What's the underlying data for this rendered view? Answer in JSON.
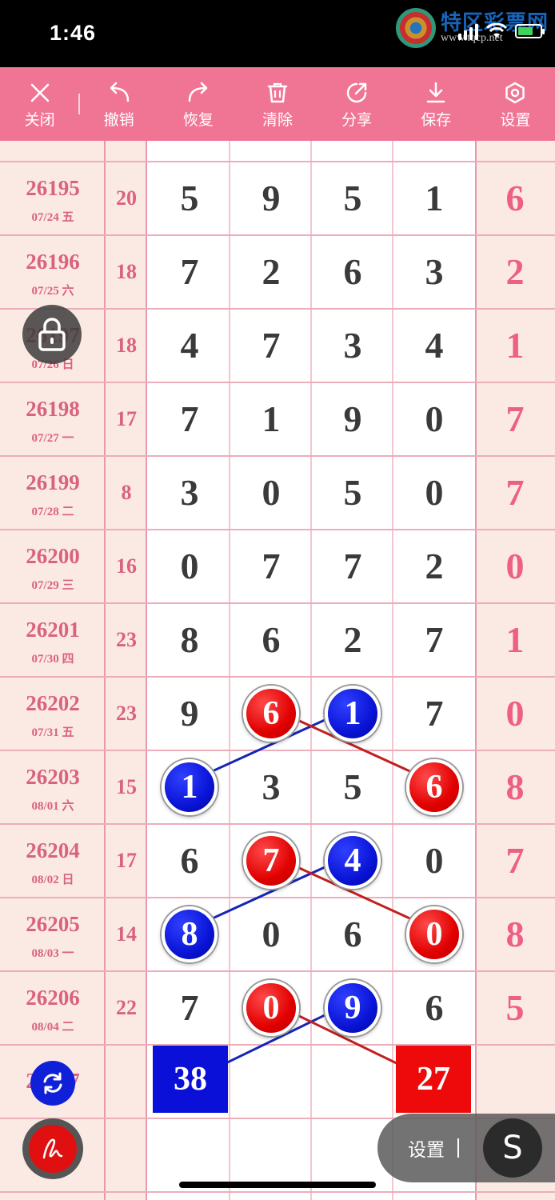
{
  "status_bar": {
    "time": "1:46"
  },
  "watermark": {
    "brand": "特区彩票网",
    "url": "www.tqcp.net"
  },
  "toolbar": {
    "close": "关闭",
    "undo": "撤销",
    "redo": "恢复",
    "clear": "清除",
    "share": "分享",
    "save": "保存",
    "settings": "设置"
  },
  "rows": [
    {
      "issue": "26195",
      "date": "07/24 五",
      "sum": "20",
      "digits": [
        "5",
        "9",
        "5",
        "1"
      ],
      "special": "6"
    },
    {
      "issue": "26196",
      "date": "07/25 六",
      "sum": "18",
      "digits": [
        "7",
        "2",
        "6",
        "3"
      ],
      "special": "2"
    },
    {
      "issue": "26197",
      "date": "07/26 日",
      "sum": "18",
      "digits": [
        "4",
        "7",
        "3",
        "4"
      ],
      "special": "1"
    },
    {
      "issue": "26198",
      "date": "07/27 一",
      "sum": "17",
      "digits": [
        "7",
        "1",
        "9",
        "0"
      ],
      "special": "7"
    },
    {
      "issue": "26199",
      "date": "07/28 二",
      "sum": "8",
      "digits": [
        "3",
        "0",
        "5",
        "0"
      ],
      "special": "7"
    },
    {
      "issue": "26200",
      "date": "07/29 三",
      "sum": "16",
      "digits": [
        "0",
        "7",
        "7",
        "2"
      ],
      "special": "0"
    },
    {
      "issue": "26201",
      "date": "07/30 四",
      "sum": "23",
      "digits": [
        "8",
        "6",
        "2",
        "7"
      ],
      "special": "1"
    },
    {
      "issue": "26202",
      "date": "07/31 五",
      "sum": "23",
      "digits": [
        "9",
        "6",
        "1",
        "7"
      ],
      "special": "0"
    },
    {
      "issue": "26203",
      "date": "08/01 六",
      "sum": "15",
      "digits": [
        "1",
        "3",
        "5",
        "6"
      ],
      "special": "8"
    },
    {
      "issue": "26204",
      "date": "08/02 日",
      "sum": "17",
      "digits": [
        "6",
        "7",
        "4",
        "0"
      ],
      "special": "7"
    },
    {
      "issue": "26205",
      "date": "08/03 一",
      "sum": "14",
      "digits": [
        "8",
        "0",
        "6",
        "0"
      ],
      "special": "8"
    },
    {
      "issue": "26206",
      "date": "08/04 二",
      "sum": "22",
      "digits": [
        "7",
        "0",
        "9",
        "6"
      ],
      "special": "5"
    }
  ],
  "next_issue": "26207",
  "totals": {
    "blue": "38",
    "red": "27"
  },
  "floating": {
    "settings_label": "设置",
    "s_glyph": "S"
  },
  "colors": {
    "toolbar": "#f07594",
    "issue_text": "#d9627f",
    "special_text": "#ee5f86",
    "ball_red": "#e10000",
    "ball_blue": "#0a14d6"
  }
}
